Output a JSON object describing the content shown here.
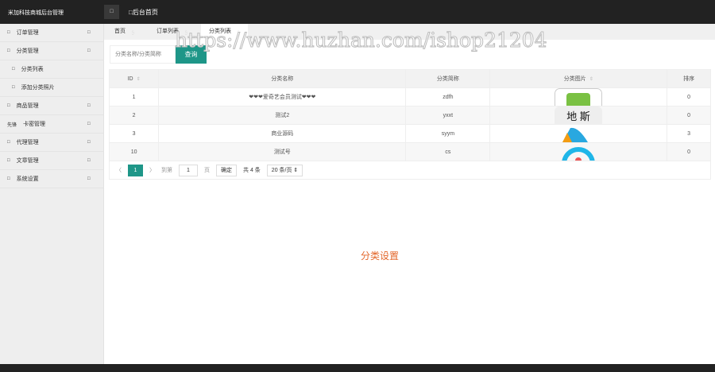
{
  "header": {
    "logo": "米加科技商城后台管理",
    "toggle_icon": "□",
    "home": "□后台首页"
  },
  "sidebar": {
    "items": [
      {
        "icon": "□",
        "label": "订单管理",
        "arrow": "□"
      },
      {
        "icon": "□",
        "label": "分类管理",
        "arrow": "□"
      },
      {
        "icon": "□",
        "label": "分类列表",
        "sub": true
      },
      {
        "icon": "□",
        "label": "添加分类照片",
        "sub": true
      },
      {
        "icon": "□",
        "label": "商品管理",
        "arrow": "□"
      },
      {
        "icon": "先锋",
        "label": "卡密管理",
        "arrow": "□"
      },
      {
        "icon": "□",
        "label": "代理管理",
        "arrow": "□"
      },
      {
        "icon": "□",
        "label": "文章管理",
        "arrow": "□"
      },
      {
        "icon": "□",
        "label": "系统设置",
        "arrow": "□"
      }
    ]
  },
  "tabs": [
    {
      "label": "首页",
      "close": "ဌ"
    },
    {
      "label": "订单列表",
      "close": "ဌ"
    },
    {
      "label": "分类列表",
      "close": "ဌ"
    }
  ],
  "search": {
    "placeholder": "分类名称/分类简称",
    "button": "查询"
  },
  "table": {
    "headers": [
      "ID",
      "分类名称",
      "分类简称",
      "分类图片",
      "排序"
    ],
    "rows": [
      [
        "1",
        "❤❤❤爱奇艺会员测试❤❤❤",
        "zdfh",
        "",
        "0"
      ],
      [
        "2",
        "测试2",
        "yxxt",
        "",
        "0"
      ],
      [
        "3",
        "商业源码",
        "syym",
        "",
        "3"
      ],
      [
        "10",
        "测试号",
        "cs",
        "",
        "0"
      ]
    ]
  },
  "pager": {
    "prev": "〈",
    "current": "1",
    "next": "〉",
    "goto": "到第",
    "page_value": "1",
    "page_unit": "页",
    "confirm": "确定",
    "total": "共 4 条",
    "per_page": "20 条/页 ⇕"
  },
  "center_text": "分类设置",
  "watermark": "https://www.huzhan.com/ishop21204",
  "colors": {
    "accent": "#1e9688",
    "center": "#e3672b"
  }
}
